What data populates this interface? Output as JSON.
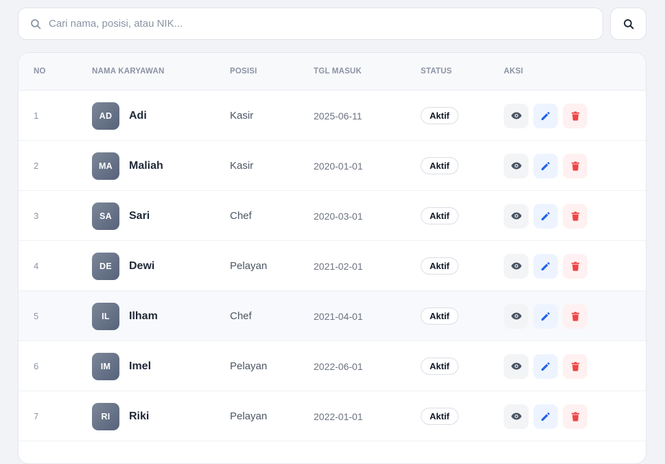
{
  "search": {
    "placeholder": "Cari nama, posisi, atau NIK..."
  },
  "table": {
    "headers": {
      "no": "NO",
      "name": "NAMA KARYAWAN",
      "position": "POSISI",
      "start_date": "TGL MASUK",
      "status": "STATUS",
      "actions": "AKSI"
    },
    "rows": [
      {
        "no": "1",
        "initials": "AD",
        "name": "Adi",
        "position": "Kasir",
        "start_date": "2025-06-11",
        "status": "Aktif"
      },
      {
        "no": "2",
        "initials": "MA",
        "name": "Maliah",
        "position": "Kasir",
        "start_date": "2020-01-01",
        "status": "Aktif"
      },
      {
        "no": "3",
        "initials": "SA",
        "name": "Sari",
        "position": "Chef",
        "start_date": "2020-03-01",
        "status": "Aktif"
      },
      {
        "no": "4",
        "initials": "DE",
        "name": "Dewi",
        "position": "Pelayan",
        "start_date": "2021-02-01",
        "status": "Aktif"
      },
      {
        "no": "5",
        "initials": "IL",
        "name": "Ilham",
        "position": "Chef",
        "start_date": "2021-04-01",
        "status": "Aktif"
      },
      {
        "no": "6",
        "initials": "IM",
        "name": "Imel",
        "position": "Pelayan",
        "start_date": "2022-06-01",
        "status": "Aktif"
      },
      {
        "no": "7",
        "initials": "RI",
        "name": "Riki",
        "position": "Pelayan",
        "start_date": "2022-01-01",
        "status": "Aktif"
      }
    ]
  },
  "colors": {
    "view": "#4b5563",
    "edit": "#2563eb",
    "delete": "#ef4444",
    "hover_row": "#f8f9fc"
  },
  "icons": {
    "search": "search-icon",
    "view": "eye-icon",
    "edit": "pencil-icon",
    "delete": "trash-icon"
  }
}
